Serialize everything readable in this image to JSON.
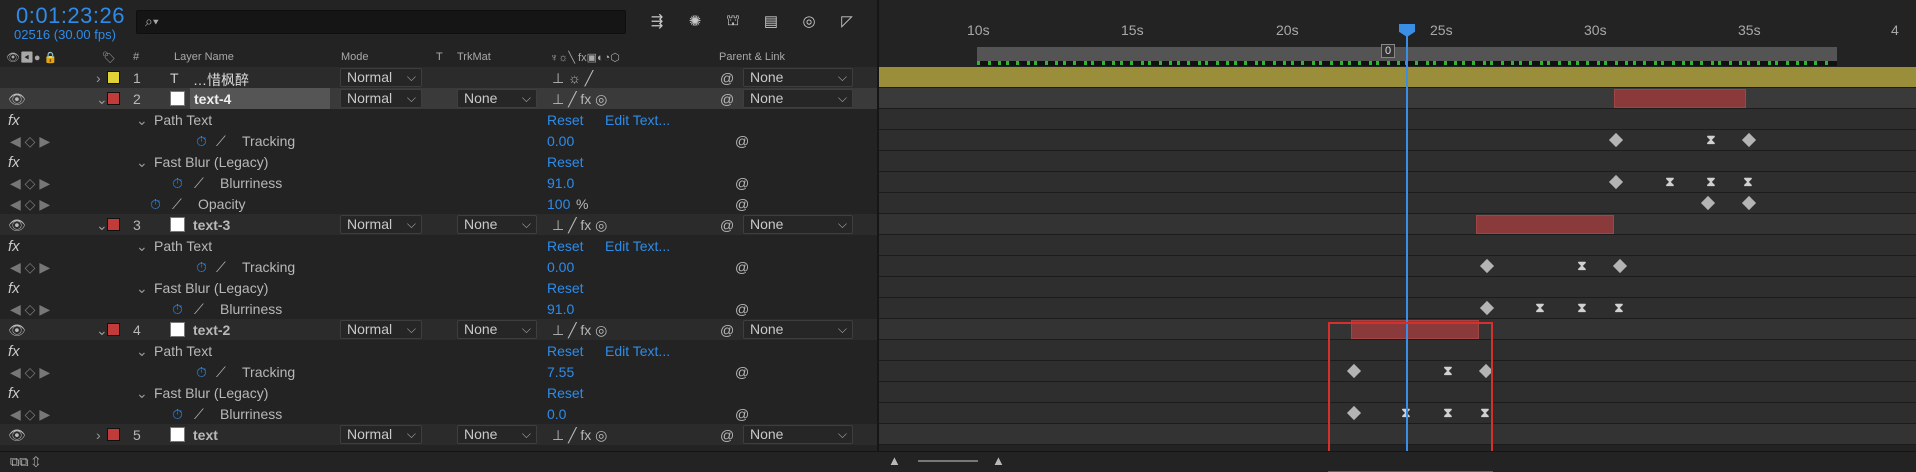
{
  "header": {
    "timecode": "0:01:23:26",
    "frames_fps": "02516 (30.00 fps)",
    "search_placeholder": ""
  },
  "columns": {
    "num": "#",
    "layer_name": "Layer Name",
    "mode": "Mode",
    "t": "T",
    "trkmat": "TrkMat",
    "parent": "Parent & Link"
  },
  "labels": {
    "reset": "Reset",
    "edit_text": "Edit Text...",
    "fx": "fx",
    "percent": "%"
  },
  "layers": [
    {
      "num": "1",
      "type": "T",
      "name": "…惜枫醉",
      "color": "#e0d236",
      "mode": "Normal",
      "trkmat": "",
      "parent": "None"
    },
    {
      "num": "2",
      "name": "text-4",
      "color": "#c23b3b",
      "mode": "Normal",
      "trkmat": "None",
      "parent": "None"
    },
    {
      "num": "3",
      "name": "text-3",
      "color": "#c23b3b",
      "mode": "Normal",
      "trkmat": "None",
      "parent": "None"
    },
    {
      "num": "4",
      "name": "text-2",
      "color": "#c23b3b",
      "mode": "Normal",
      "trkmat": "None",
      "parent": "None"
    },
    {
      "num": "5",
      "name": "text",
      "color": "#c23b3b",
      "mode": "Normal",
      "trkmat": "None",
      "parent": "None"
    }
  ],
  "props": {
    "path_text": "Path Text",
    "tracking": "Tracking",
    "fast_blur": "Fast Blur (Legacy)",
    "blurriness": "Blurriness",
    "opacity": "Opacity",
    "l2_tracking": "0.00",
    "l2_blur": "91.0",
    "l2_opacity": "100",
    "l3_tracking": "0.00",
    "l3_blur": "91.0",
    "l4_tracking": "7.55",
    "l4_blur": "0.0"
  },
  "timeline": {
    "ticks": [
      "10s",
      "15s",
      "20s",
      "25s",
      "30s",
      "35s",
      "4"
    ],
    "cti_label": "0",
    "accent": "#2d8ceb"
  }
}
